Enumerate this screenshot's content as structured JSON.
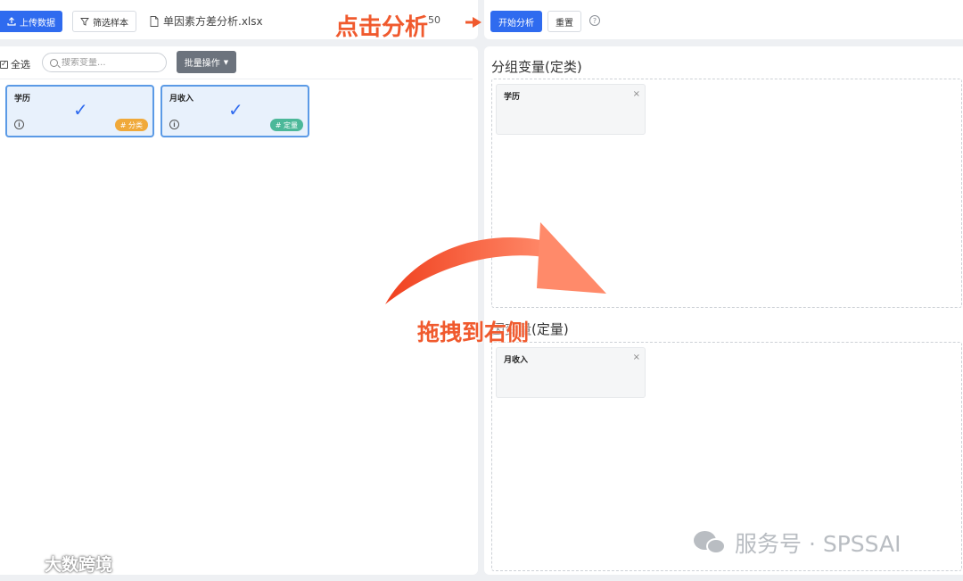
{
  "toolbar_left": {
    "upload_label": "上传数据",
    "filter_label": "筛选样本",
    "file_name": "单因素方差分析.xlsx",
    "sample_count": "50"
  },
  "toolbar_right": {
    "start_label": "开始分析",
    "reset_label": "重置",
    "help_symbol": "?"
  },
  "variables_panel": {
    "select_all_label": "全选",
    "search_placeholder": "搜索变量...",
    "batch_label": "批量操作",
    "cards": [
      {
        "name": "学历",
        "tag": "# 分类",
        "tag_type": "categorical"
      },
      {
        "name": "月收入",
        "tag": "# 定量",
        "tag_type": "quantitative"
      }
    ]
  },
  "analysis_panel": {
    "group_title": "分组变量(定类)",
    "group_items": [
      "学历"
    ],
    "dep_title": "因变量(定量)",
    "dep_items": [
      "月收入"
    ]
  },
  "annotations": {
    "click_hint": "点击分析",
    "drag_hint": "拖拽到右侧"
  },
  "watermark": "服务号 · SPSSAI",
  "brand": "大数跨境",
  "colors": {
    "primary": "#2f6bef",
    "annotation": "#f05a2e",
    "tag_categorical": "#f0a93a",
    "tag_quantitative": "#4cb899"
  }
}
